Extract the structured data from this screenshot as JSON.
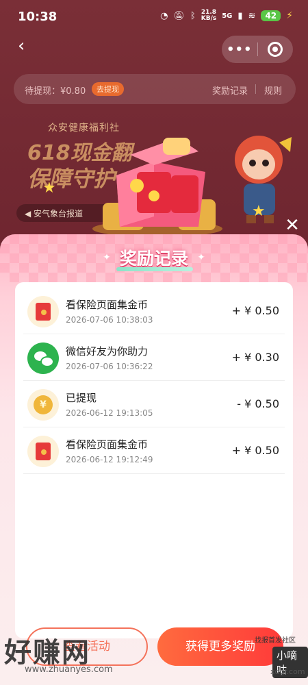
{
  "status": {
    "time": "10:38",
    "net_speed_value": "21.8",
    "net_speed_unit": "KB/s",
    "signal": "5G",
    "battery": "42"
  },
  "nav": {
    "back_icon": "chevron-left-icon",
    "more_icon": "more-icon",
    "close_icon": "target-icon"
  },
  "pending": {
    "text": "待提现：¥0.80",
    "button": "去提现",
    "records": "奖励记录",
    "rules": "规则"
  },
  "banner": {
    "brand": "众安健康福利社",
    "line1": "618现金翻",
    "line2": "保障守护",
    "pill": "安气象台报道"
  },
  "sheet": {
    "title": "奖励记录",
    "close_icon": "close-icon",
    "records": [
      {
        "icon": "red-envelope-icon",
        "title": "看保险页面集金币",
        "time": "2026-07-06 10:38:03",
        "amount": "+ ¥ 0.50"
      },
      {
        "icon": "wechat-icon",
        "title": "微信好友为你助力",
        "time": "2026-07-06 10:36:22",
        "amount": "+ ¥ 0.30"
      },
      {
        "icon": "yuan-coin-icon",
        "title": "已提现",
        "time": "2026-06-12 19:13:05",
        "amount": "- ¥ 0.50"
      },
      {
        "icon": "red-envelope-icon",
        "title": "看保险页面集金币",
        "time": "2026-06-12 19:12:49",
        "amount": "+ ¥ 0.50"
      }
    ],
    "btn_left": "查看活动",
    "btn_right": "获得更多奖励"
  },
  "watermark": {
    "left_text": "好赚网",
    "left_url": "www.zhuanyes.com",
    "right_small": "找报首发社区",
    "right_badge": "小嘀咕",
    "right_url": "xdgf.com"
  }
}
